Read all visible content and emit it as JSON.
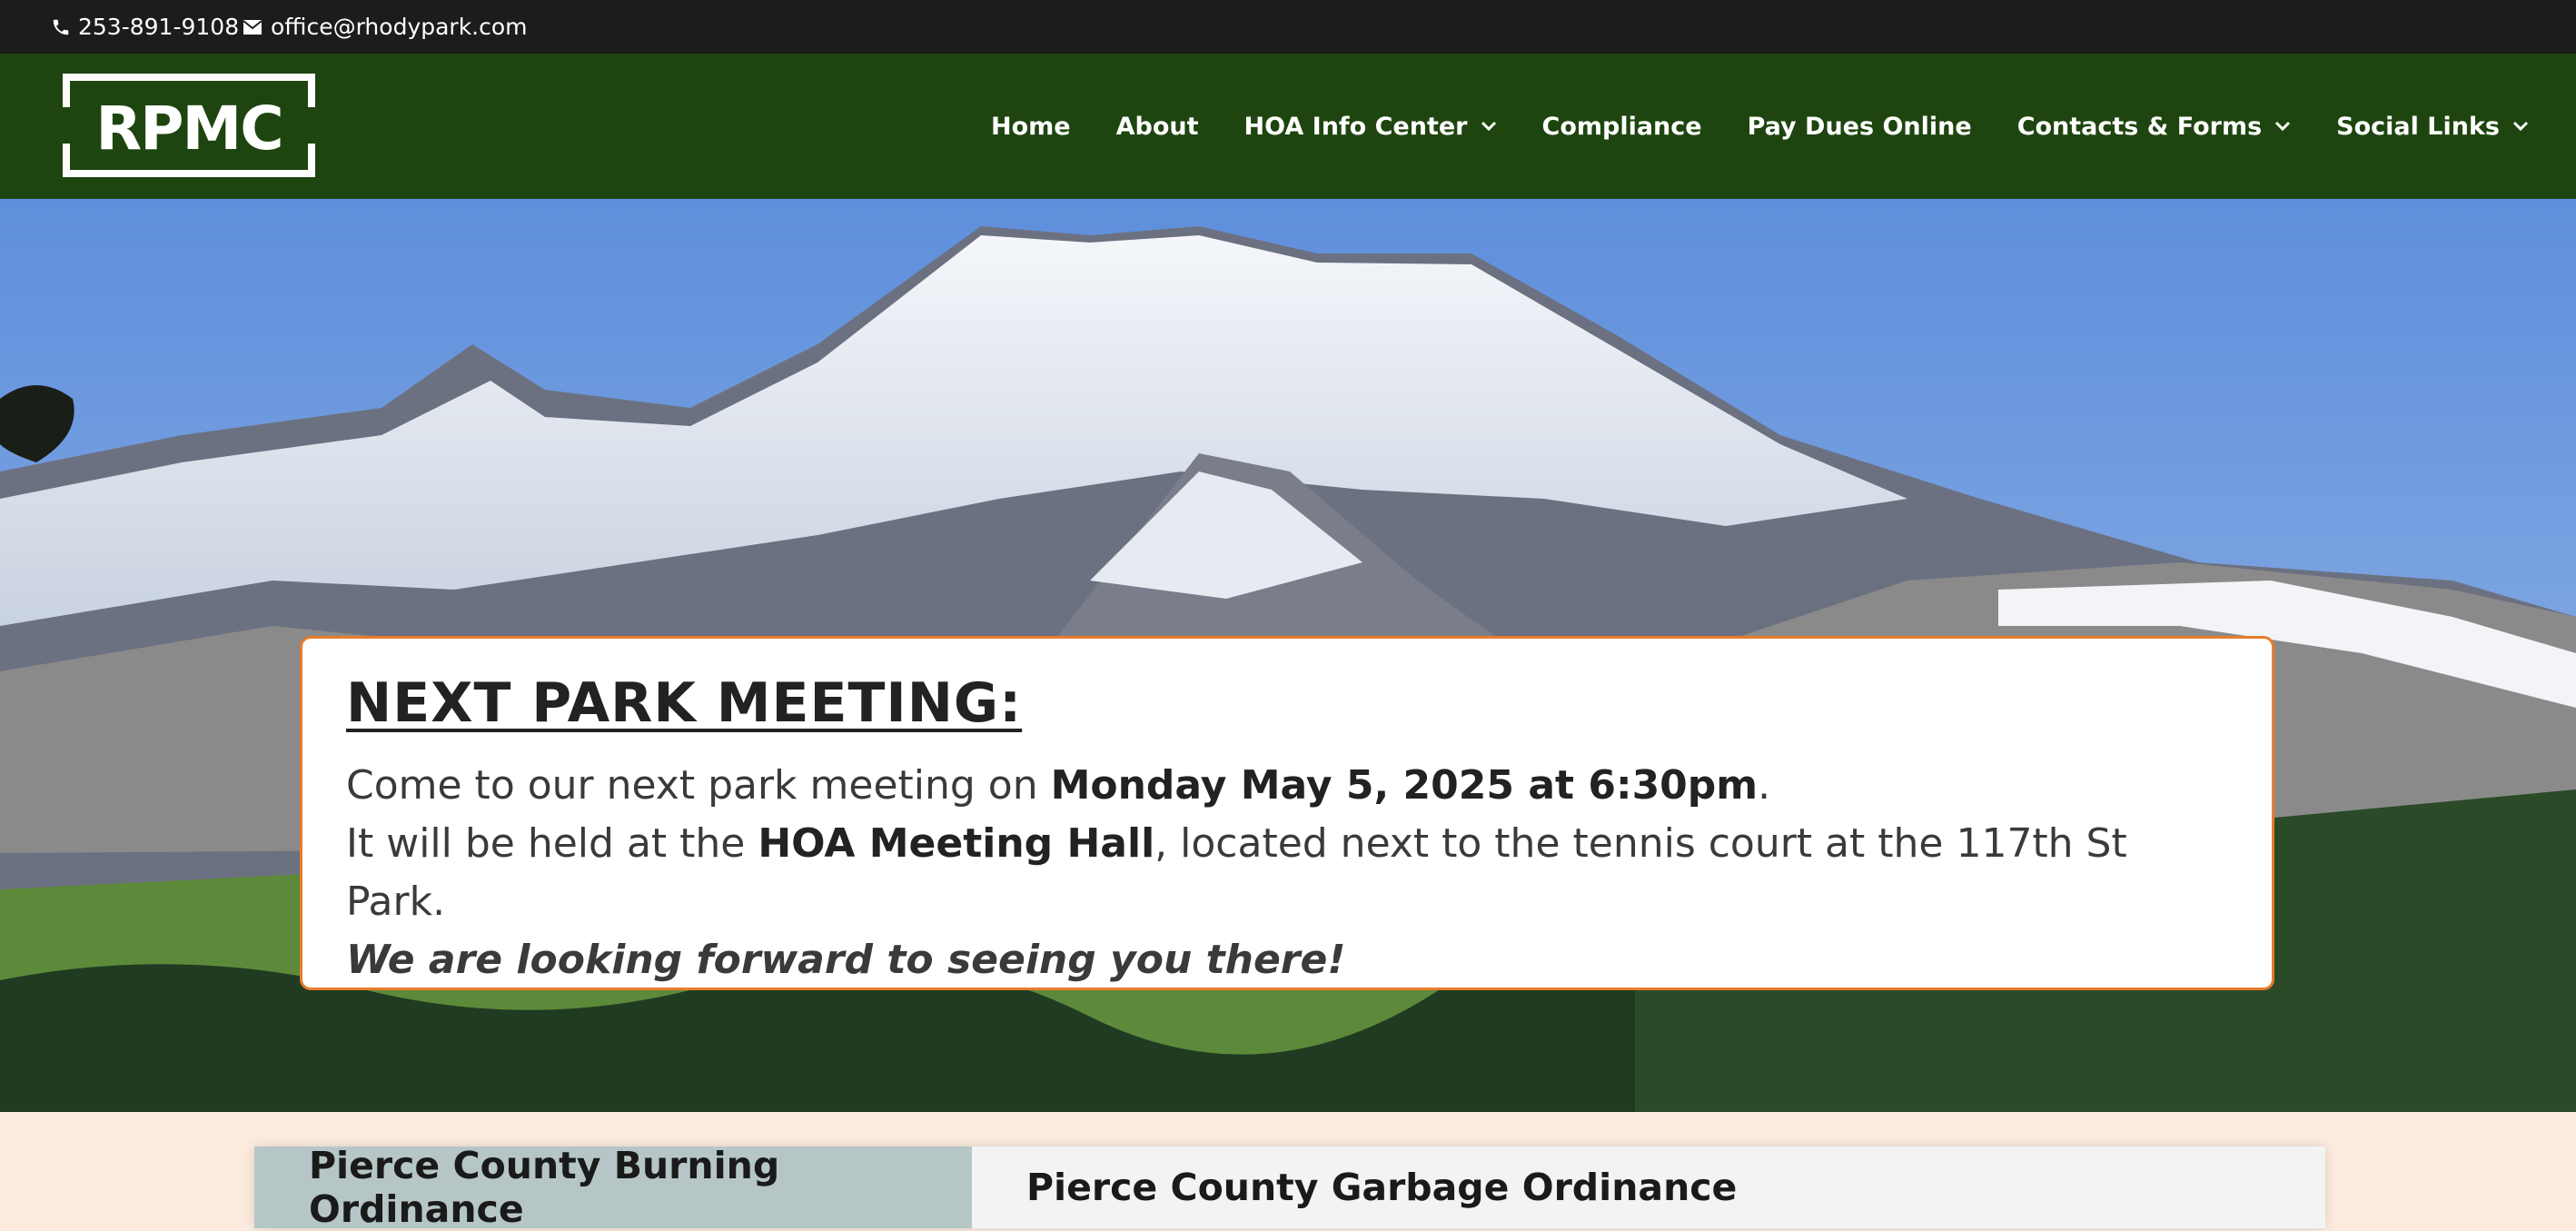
{
  "topbar": {
    "phone": "253-891-9108",
    "email": "office@rhodypark.com"
  },
  "header": {
    "logo_text": "RPMC",
    "nav": [
      {
        "label": "Home",
        "dropdown": false
      },
      {
        "label": "About",
        "dropdown": false
      },
      {
        "label": "HOA Info Center",
        "dropdown": true
      },
      {
        "label": "Compliance",
        "dropdown": false
      },
      {
        "label": "Pay Dues Online",
        "dropdown": false
      },
      {
        "label": "Contacts & Forms",
        "dropdown": true
      },
      {
        "label": "Social Links",
        "dropdown": true
      }
    ]
  },
  "meeting": {
    "heading": "NEXT PARK MEETING:",
    "line1_pre": "Come to our next park meeting on ",
    "line1_bold": "Monday May 5, 2025 at 6:30pm",
    "line1_post": ".",
    "line2_pre": "It will be held at the ",
    "line2_bold": "HOA Meeting Hall",
    "line2_post": ", located next to the tennis court at the 117th St Park.",
    "line3": "We are looking forward to seeing you there!"
  },
  "tabs": [
    {
      "label": "Pierce County Burning Ordinance",
      "active": true
    },
    {
      "label": "Pierce County Garbage Ordinance",
      "active": false
    }
  ],
  "colors": {
    "topbar": "#1c1c1c",
    "nav": "#1e450f",
    "card_border": "#e87c2c",
    "page_bg": "#fbeadd",
    "tab_active": "#b6c6c6"
  }
}
